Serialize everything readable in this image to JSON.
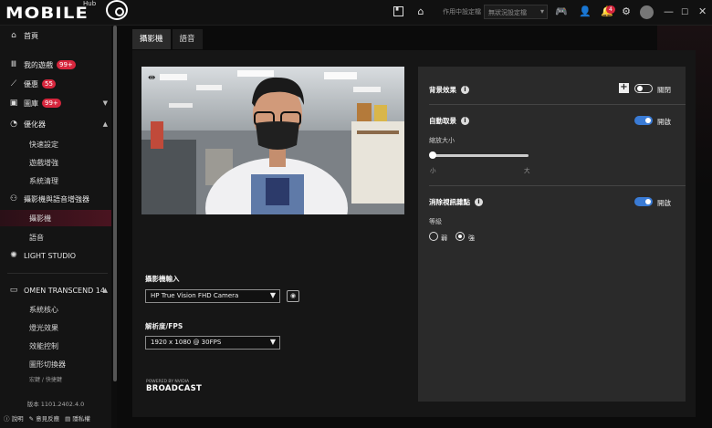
{
  "app": {
    "logo_text": "MOBILE",
    "logo_sup": "Hub"
  },
  "titlebar": {
    "mode_label": "作用中設定檔",
    "mode_value": "無狀況設定檔",
    "notification_count": "4"
  },
  "sidebar": {
    "items": [
      {
        "label": "首頁",
        "icon": "home-icon"
      },
      {
        "label": "我的遊戲",
        "badge": "99+",
        "icon": "library-icon"
      },
      {
        "label": "優惠",
        "badge": "55",
        "icon": "trend-icon"
      },
      {
        "label": "圖庫",
        "badge": "99+",
        "icon": "gallery-icon"
      },
      {
        "label": "優化器",
        "icon": "gauge-icon"
      },
      {
        "label": "攝影機與語音增強器",
        "icon": "camera-mic-icon"
      },
      {
        "label": "LIGHT STUDIO",
        "icon": "light-icon"
      },
      {
        "label": "OMEN TRANSCEND 14",
        "icon": "laptop-icon"
      }
    ],
    "optimizer_sub": [
      "快速設定",
      "遊戲增強",
      "系統清理"
    ],
    "camera_sub": [
      "攝影機",
      "語音"
    ],
    "device_sub": [
      "系統核心",
      "燈光效果",
      "效能控制",
      "圖形切換器",
      "宏鍵 / 快捷鍵"
    ],
    "version": "版本 1101.2402.4.0",
    "footer": [
      "說明",
      "意見反應",
      "隱私權"
    ]
  },
  "tabs": [
    "攝影機",
    "語音"
  ],
  "camera": {
    "input_label": "攝影機輸入",
    "input_value": "HP True Vision FHD Camera",
    "resolution_label": "解析度/FPS",
    "resolution_value": "1920 x 1080 @ 30FPS",
    "powered_by": "POWERED BY NVIDIA",
    "broadcast": "BROADCAST"
  },
  "settings": {
    "bg_effect": {
      "label": "背景效果",
      "state": "關閉",
      "enabled": false
    },
    "auto_frame": {
      "label": "自動取景",
      "state": "開啟",
      "enabled": true
    },
    "zoom_label": "縮放大小",
    "zoom_min": "小",
    "zoom_max": "大",
    "zoom_value": 0,
    "noise": {
      "label": "消除視訊雜點",
      "state": "開啟",
      "enabled": true
    },
    "level_label": "等級",
    "levels": [
      {
        "label": "弱",
        "selected": false
      },
      {
        "label": "強",
        "selected": true
      }
    ]
  },
  "colors": {
    "accent": "#3a7bd5",
    "badge": "#d7263d",
    "active_nav": "#4a1420"
  }
}
